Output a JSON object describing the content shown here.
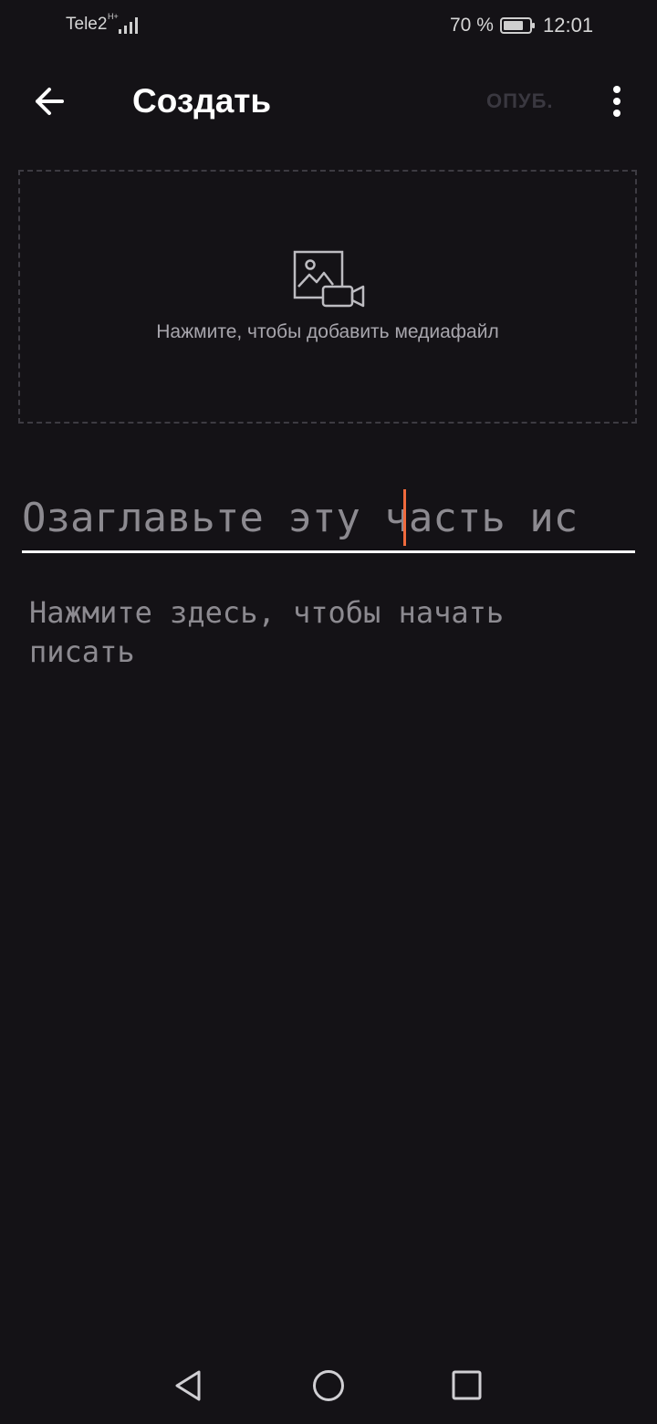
{
  "status_bar": {
    "carrier": "Tele2",
    "network_type": "H+",
    "battery_percent": "70 %",
    "time": "12:01",
    "icons": [
      "signal-icon",
      "battery-icon"
    ]
  },
  "app_bar": {
    "back_icon": "arrow-left-icon",
    "title": "Создать",
    "publish_label": "ОПУБ.",
    "more_icon": "more-vertical-icon"
  },
  "media": {
    "icon": "image-video-icon",
    "hint": "Нажмите, чтобы добавить медиафайл"
  },
  "title_input": {
    "placeholder": "Озаглавьте эту часть ис",
    "cursor_color": "#ef6a3d"
  },
  "body_input": {
    "placeholder": "Нажмите здесь, чтобы начать писать"
  },
  "nav_bar": {
    "icons": [
      "nav-back-icon",
      "nav-home-icon",
      "nav-recents-icon"
    ]
  },
  "colors": {
    "background": "#141216",
    "accent": "#ef6a3d",
    "placeholder_text": "#8c8a90",
    "disabled_action": "#3a3840"
  }
}
